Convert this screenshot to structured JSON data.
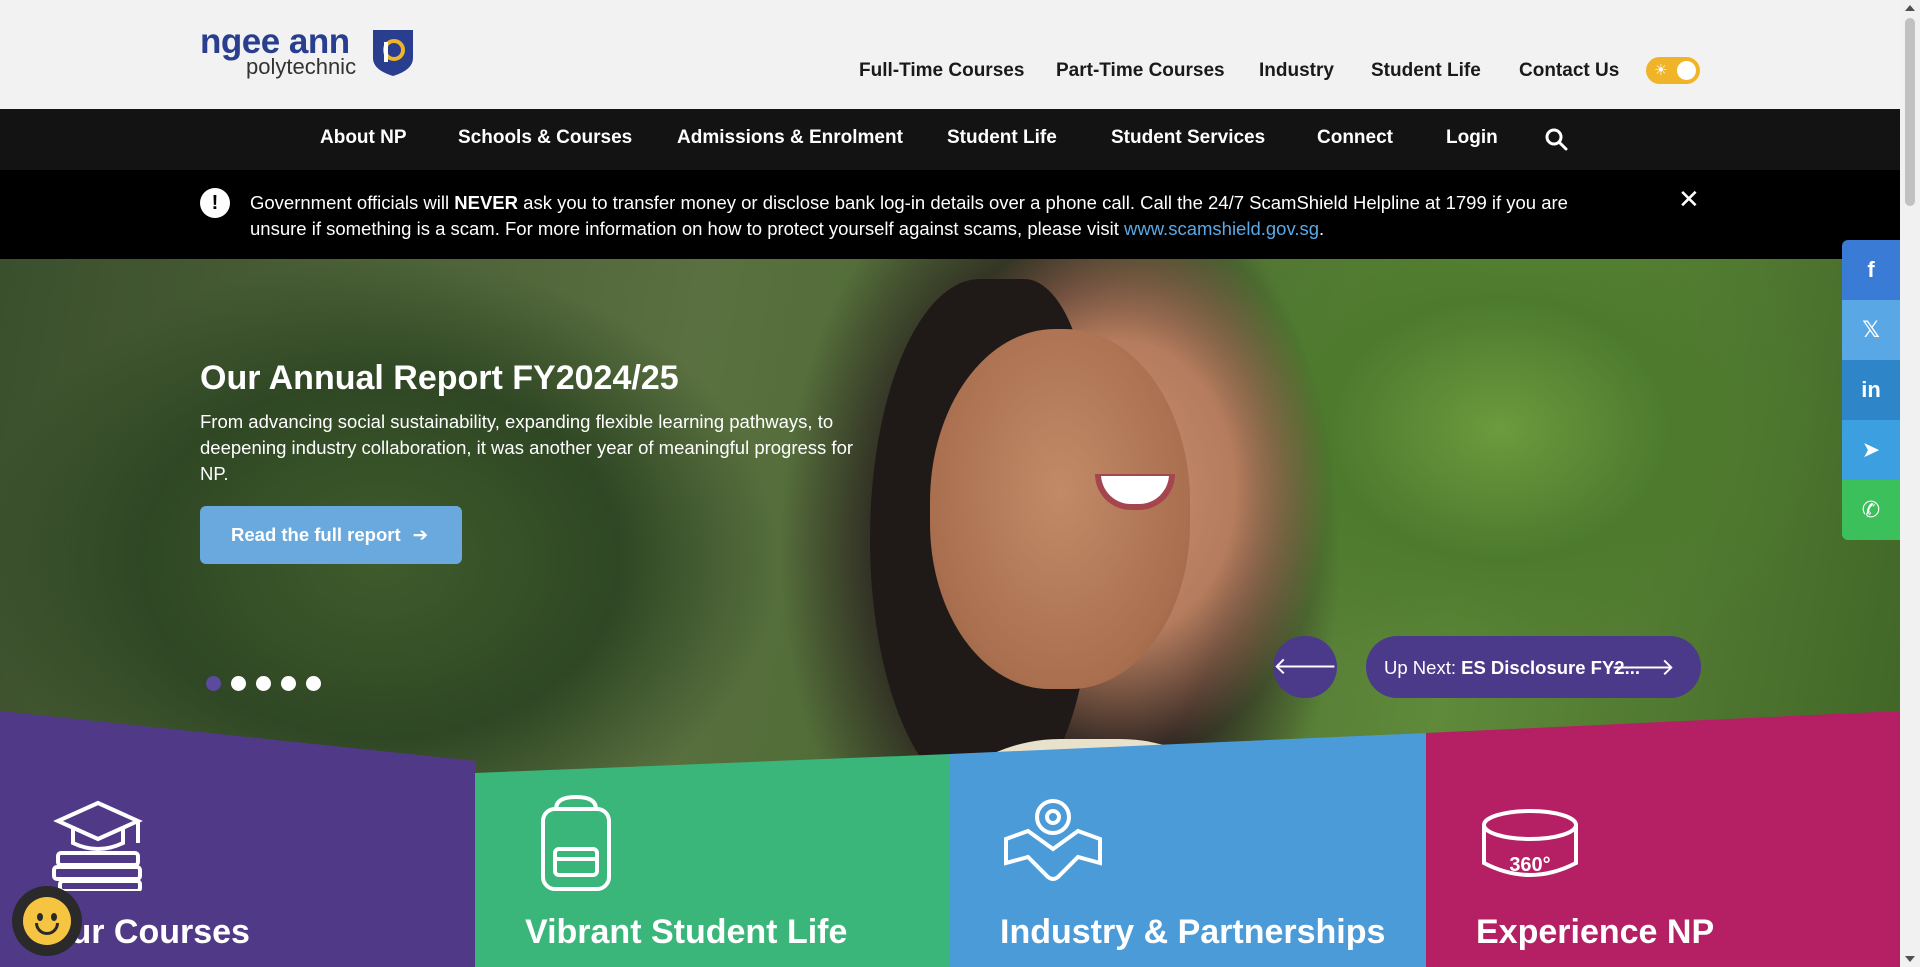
{
  "logo": {
    "main": "ngee ann",
    "sub": "polytechnic"
  },
  "top_links": [
    "Full-Time Courses",
    "Part-Time Courses",
    "Industry",
    "Student Life",
    "Contact Us"
  ],
  "theme_toggle": {
    "icon": "sun-icon",
    "color": "#f0b429"
  },
  "main_nav": [
    "About NP",
    "Schools & Courses",
    "Admissions & Enrolment",
    "Student Life",
    "Student Services",
    "Connect",
    "Login"
  ],
  "alert": {
    "text_before": "Government officials will ",
    "text_bold": "NEVER",
    "text_after": " ask you to transfer money or disclose bank log-in details over a phone call. Call the 24/7 ScamShield Helpline at 1799 if you are unsure if something is a scam. For more information on how to protect yourself against scams, please visit ",
    "link": "www.scamshield.gov.sg",
    "text_end": "."
  },
  "hero": {
    "title": "Our Annual Report FY2024/25",
    "description": "From advancing social sustainability, expanding flexible learning pathways, to deepening industry collaboration, it was another year of meaningful progress for NP.",
    "button": "Read the full report",
    "slide_count": 5,
    "active_slide": 1,
    "next_prefix": "Up Next: ",
    "next_title": "ES Disclosure FY2..."
  },
  "tiles": [
    {
      "title": "Our Courses",
      "icon": "graduation-books-icon",
      "color": "#503a87"
    },
    {
      "title": "Vibrant Student Life",
      "icon": "backpack-icon",
      "color": "#3bb67a"
    },
    {
      "title": "Industry & Partnerships",
      "icon": "handshake-icon",
      "color": "#4b9bd8"
    },
    {
      "title": "Experience NP",
      "icon": "360-view-icon",
      "color": "#b51f63"
    }
  ],
  "social": [
    {
      "name": "facebook",
      "glyph": "f",
      "color": "#3a7bd5"
    },
    {
      "name": "x",
      "glyph": "𝕏",
      "color": "#5aa7e6"
    },
    {
      "name": "linkedin",
      "glyph": "in",
      "color": "#2e86c8"
    },
    {
      "name": "telegram",
      "glyph": "➤",
      "color": "#3b9fe0"
    },
    {
      "name": "whatsapp",
      "glyph": "✆",
      "color": "#3cc05c"
    }
  ]
}
